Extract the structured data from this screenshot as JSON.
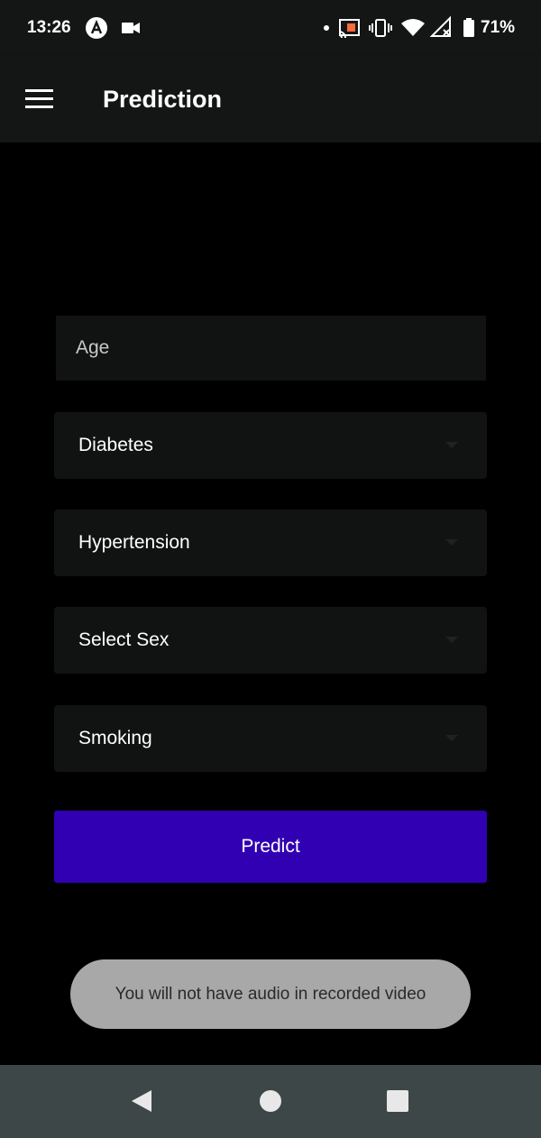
{
  "status_bar": {
    "time": "13:26",
    "battery_percent": "71%",
    "icons": [
      "a-logo-icon",
      "video-camera-icon",
      "dot-icon",
      "cast-icon",
      "vibrate-icon",
      "wifi-icon",
      "no-signal-icon",
      "battery-icon"
    ]
  },
  "app_bar": {
    "title": "Prediction",
    "menu_icon": "hamburger-menu-icon"
  },
  "form": {
    "age_placeholder": "Age",
    "diabetes_label": "Diabetes",
    "hypertension_label": "Hypertension",
    "sex_label": "Select Sex",
    "smoking_label": "Smoking",
    "predict_label": "Predict"
  },
  "toast": {
    "message": "You will not have audio in recorded video"
  },
  "nav_bar": {
    "icons": [
      "back-icon",
      "home-icon",
      "recents-icon"
    ]
  },
  "colors": {
    "background": "#000000",
    "app_bar": "#141615",
    "field": "#111312",
    "accent": "#3100b2",
    "toast": "#a8a8a8",
    "nav_bar": "#3e4747"
  }
}
